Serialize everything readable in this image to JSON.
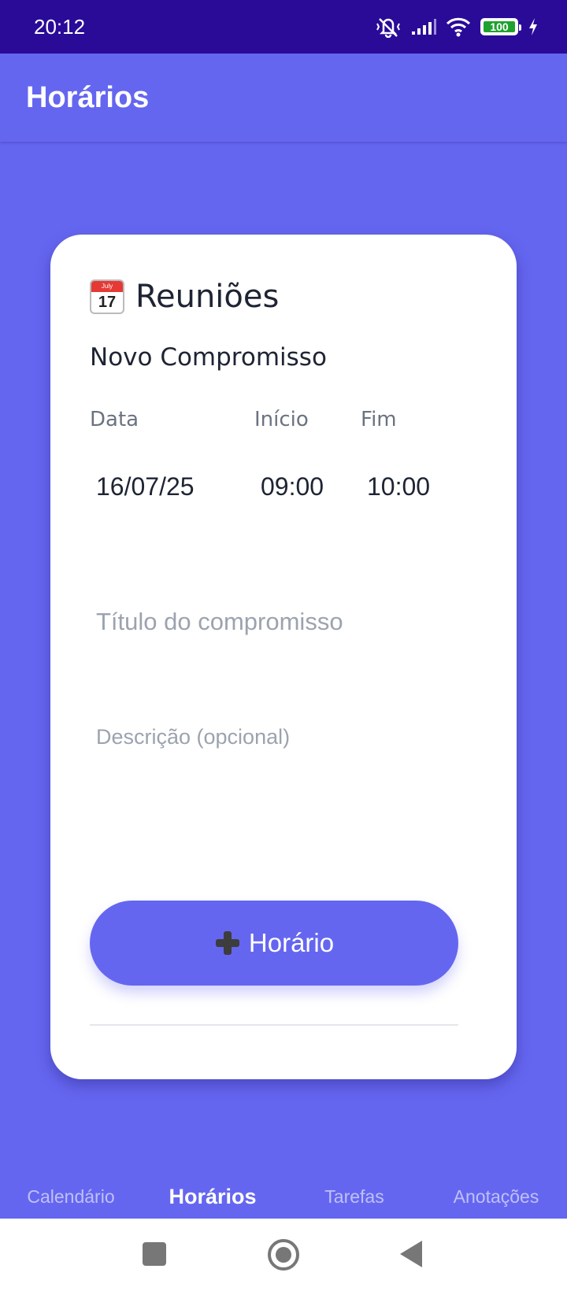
{
  "status_bar": {
    "time": "20:12",
    "battery": "100"
  },
  "app_bar": {
    "title": "Horários"
  },
  "card": {
    "icon": "calendar-icon",
    "icon_month": "July",
    "icon_day": "17",
    "title": "Reuniões",
    "section_title": "Novo Compromisso",
    "labels": {
      "date": "Data",
      "start": "Início",
      "end": "Fim"
    },
    "values": {
      "date": "16/07/25",
      "start": "09:00",
      "end": "10:00"
    },
    "title_placeholder": "Título do compromisso",
    "description_placeholder": "Descrição (opcional)",
    "add_button_label": "Horário"
  },
  "tabs": [
    {
      "label": "Calendário",
      "active": false
    },
    {
      "label": "Horários",
      "active": true
    },
    {
      "label": "Tarefas",
      "active": false
    },
    {
      "label": "Anotações",
      "active": false
    }
  ],
  "colors": {
    "primary": "#6566F0",
    "status_bar": "#2A0B98",
    "card": "#FFFFFF"
  }
}
